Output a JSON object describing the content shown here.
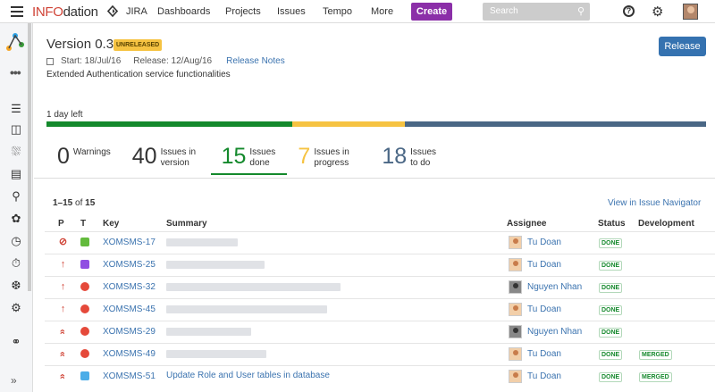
{
  "topbar": {
    "brand_part1": "INFO",
    "brand_part2": "dation",
    "app_name": "JIRA",
    "nav": [
      "Dashboards",
      "Projects",
      "Issues",
      "Tempo",
      "More"
    ],
    "create_label": "Create",
    "search_placeholder": "Search"
  },
  "version": {
    "title": "Version 0.3",
    "status_badge": "UNRELEASED",
    "release_button": "Release",
    "start": "Start: 18/Jul/16",
    "release": "Release: 12/Aug/16",
    "release_notes_link": "Release Notes",
    "description": "Extended Authentication service functionalities",
    "days_left": "1 day left"
  },
  "progress": {
    "done_fraction": 0.373,
    "in_progress_fraction": 0.17,
    "todo_fraction": 0.457,
    "colors": {
      "done": "#14892c",
      "in_progress": "#f6c342",
      "todo": "#4a6785"
    }
  },
  "stats": [
    {
      "num": "0",
      "label": "Warnings",
      "color": "#333333",
      "active": false
    },
    {
      "num": "40",
      "label": "Issues in version",
      "color": "#333333",
      "active": false
    },
    {
      "num": "15",
      "label": "Issues done",
      "color": "#14892c",
      "active": true
    },
    {
      "num": "7",
      "label": "Issues in progress",
      "color": "#f6c342",
      "active": false
    },
    {
      "num": "18",
      "label": "Issues to do",
      "color": "#4a6785",
      "active": false
    }
  ],
  "list": {
    "range": "1–15",
    "of_text": "of",
    "total": "15",
    "navigator_link": "View in Issue Navigator",
    "headers": {
      "p": "P",
      "t": "T",
      "key": "Key",
      "summary": "Summary",
      "assignee": "Assignee",
      "status": "Status",
      "development": "Development"
    }
  },
  "rows": [
    {
      "priority": "blocker",
      "type": "story",
      "key": "XOMSMS-17",
      "summary": "",
      "assignee": "Tu Doan",
      "avatar": "light",
      "status": "DONE",
      "dev": ""
    },
    {
      "priority": "high",
      "type": "epic",
      "key": "XOMSMS-25",
      "summary": "",
      "assignee": "Tu Doan",
      "avatar": "light",
      "status": "DONE",
      "dev": ""
    },
    {
      "priority": "high",
      "type": "bug",
      "key": "XOMSMS-32",
      "summary": "",
      "assignee": "Nguyen Nhan",
      "avatar": "dark",
      "status": "DONE",
      "dev": ""
    },
    {
      "priority": "high",
      "type": "bug",
      "key": "XOMSMS-45",
      "summary": "",
      "assignee": "Tu Doan",
      "avatar": "light",
      "status": "DONE",
      "dev": ""
    },
    {
      "priority": "highest",
      "type": "bug",
      "key": "XOMSMS-29",
      "summary": "",
      "assignee": "Nguyen Nhan",
      "avatar": "dark",
      "status": "DONE",
      "dev": ""
    },
    {
      "priority": "highest",
      "type": "bug",
      "key": "XOMSMS-49",
      "summary": "",
      "assignee": "Tu Doan",
      "avatar": "light",
      "status": "DONE",
      "dev": "MERGED"
    },
    {
      "priority": "highest",
      "type": "task",
      "key": "XOMSMS-51",
      "summary": "Update Role and User tables in database",
      "assignee": "Tu Doan",
      "avatar": "light",
      "status": "DONE",
      "dev": "MERGED"
    }
  ]
}
